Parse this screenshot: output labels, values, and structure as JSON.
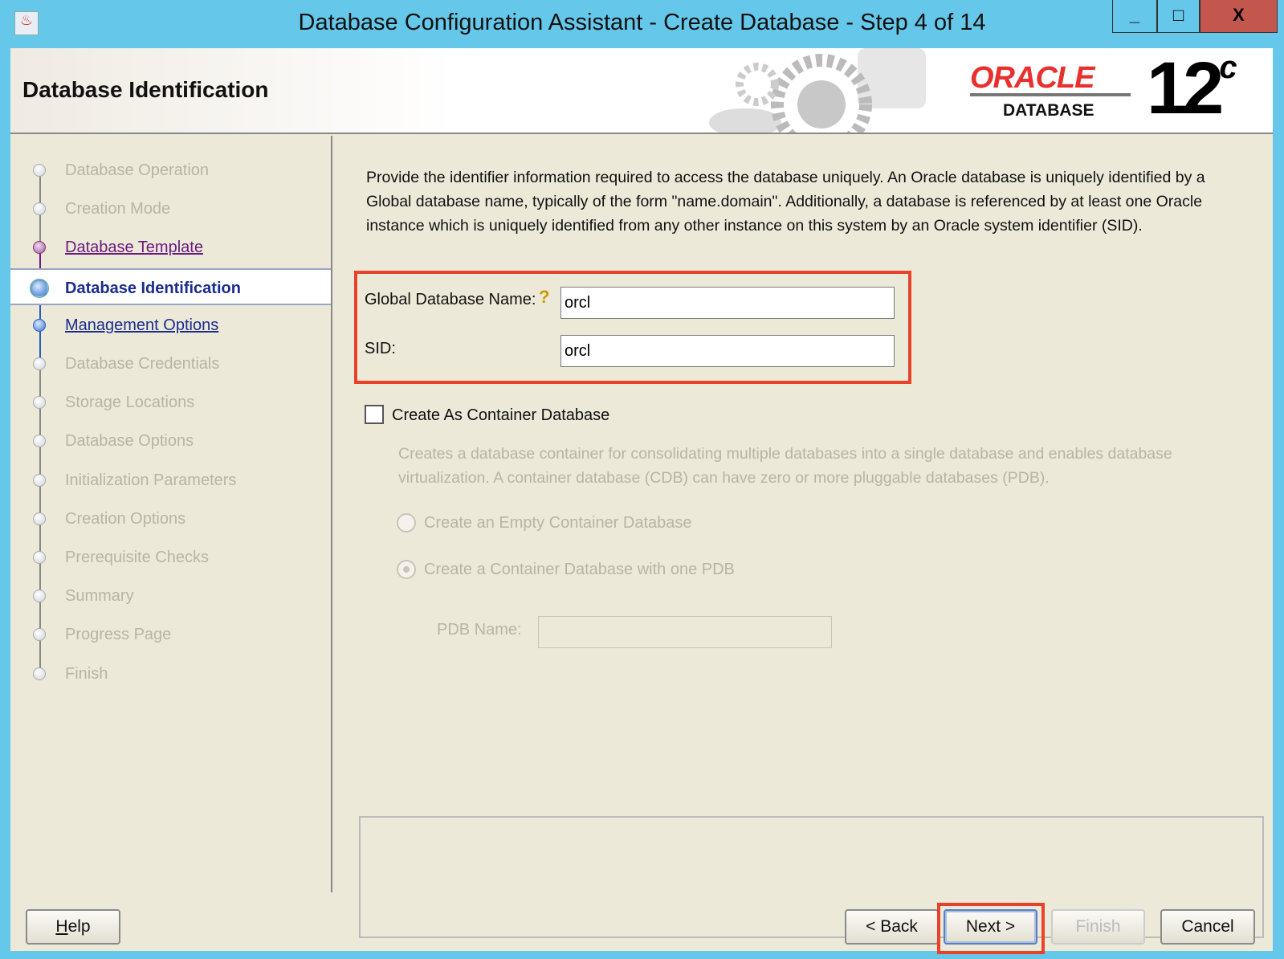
{
  "window": {
    "title": "Database Configuration Assistant - Create Database - Step 4 of 14",
    "minimize": "_",
    "maximize": "□",
    "close": "X"
  },
  "header": {
    "title": "Database Identification",
    "brand": "ORACLE",
    "brand_sub": "DATABASE",
    "version": "12",
    "version_sup": "c"
  },
  "steps": [
    {
      "label": "Database Operation",
      "state": "disabled"
    },
    {
      "label": "Creation Mode",
      "state": "disabled"
    },
    {
      "label": "Database Template",
      "state": "visited"
    },
    {
      "label": "Database Identification",
      "state": "current"
    },
    {
      "label": "Management Options",
      "state": "link"
    },
    {
      "label": "Database Credentials",
      "state": "disabled"
    },
    {
      "label": "Storage Locations",
      "state": "disabled"
    },
    {
      "label": "Database Options",
      "state": "disabled"
    },
    {
      "label": "Initialization Parameters",
      "state": "disabled"
    },
    {
      "label": "Creation Options",
      "state": "disabled"
    },
    {
      "label": "Prerequisite Checks",
      "state": "disabled"
    },
    {
      "label": "Summary",
      "state": "disabled"
    },
    {
      "label": "Progress Page",
      "state": "disabled"
    },
    {
      "label": "Finish",
      "state": "disabled"
    }
  ],
  "main": {
    "description": "Provide the identifier information required to access the database uniquely. An Oracle database is uniquely identified by a Global database name, typically of the form \"name.domain\". Additionally, a database is referenced by at least one Oracle instance which is uniquely identified from any other instance on this system by an Oracle system identifier (SID).",
    "global_name_label": "Global Database Name:",
    "global_name_value": "orcl",
    "sid_label": "SID:",
    "sid_value": "orcl",
    "container_label": "Create As Container Database",
    "container_checked": false,
    "container_desc": "Creates a database container for consolidating multiple databases into a single database and enables database virtualization. A container database (CDB) can have zero or more pluggable databases (PDB).",
    "radio_empty": "Create an Empty Container Database",
    "radio_one_pdb": "Create a Container Database with one PDB",
    "pdb_label": "PDB Name:",
    "pdb_value": ""
  },
  "buttons": {
    "help": "Help",
    "back": "< Back",
    "next": "Next >",
    "finish": "Finish",
    "cancel": "Cancel"
  }
}
